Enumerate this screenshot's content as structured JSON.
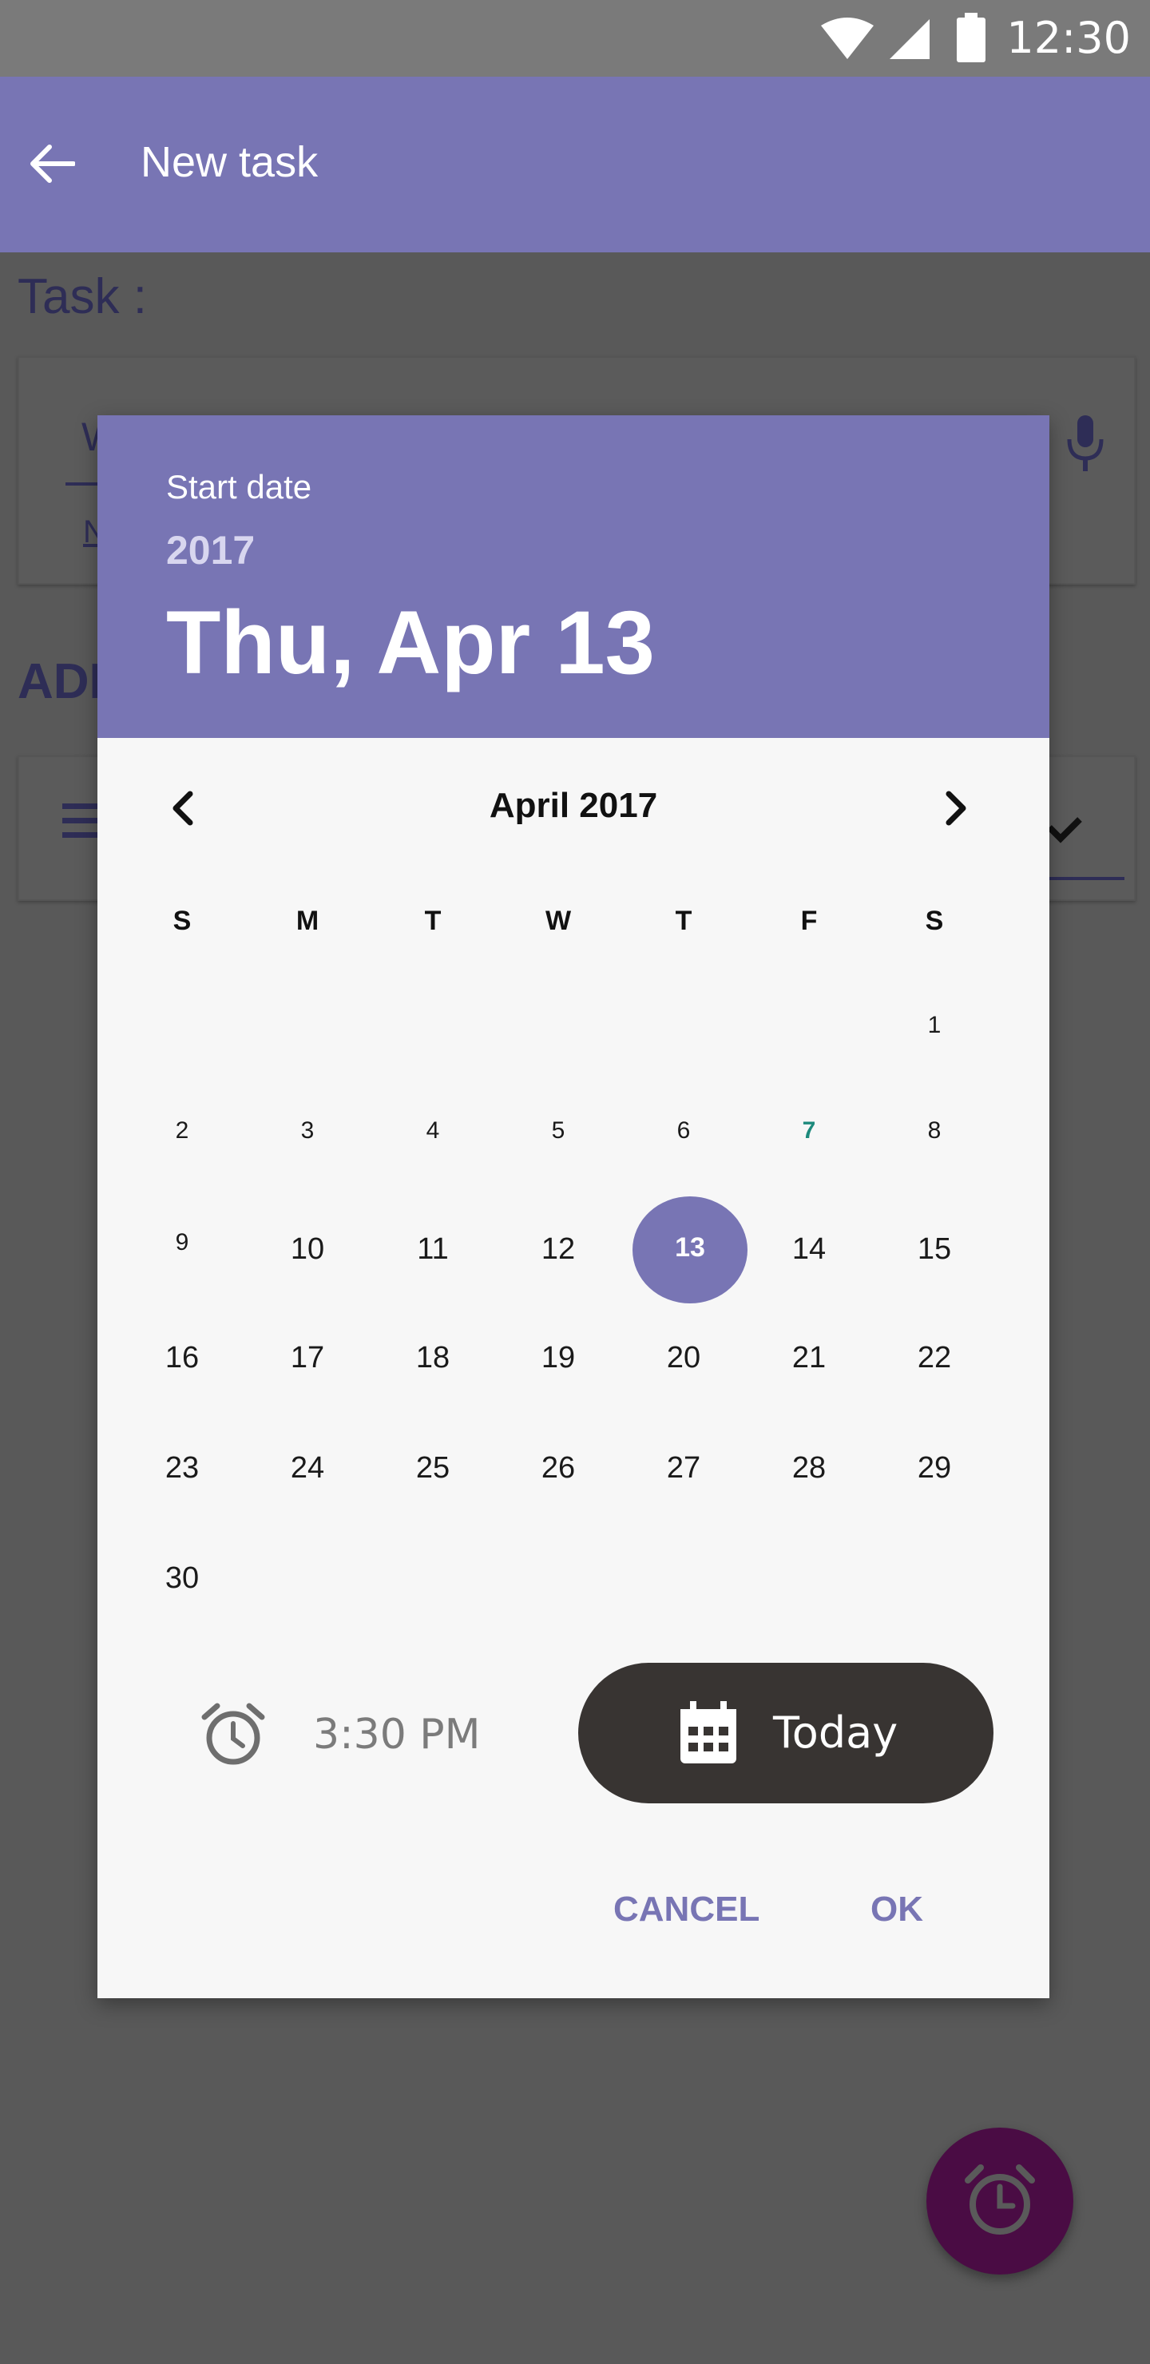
{
  "status_bar": {
    "time": "12:30"
  },
  "app_bar": {
    "title": "New task"
  },
  "background": {
    "task_label": "Task :",
    "field_letter": "W",
    "field_hint": "N",
    "section_label": "ADD"
  },
  "dialog": {
    "caption": "Start date",
    "year": "2017",
    "selected_date": "Thu, Apr 13",
    "month_title": "April 2017",
    "weekdays": [
      "S",
      "M",
      "T",
      "W",
      "T",
      "F",
      "S"
    ],
    "days": [
      "1",
      "2",
      "3",
      "4",
      "5",
      "6",
      "7",
      "8",
      "9",
      "10",
      "11",
      "12",
      "13",
      "14",
      "15",
      "16",
      "17",
      "18",
      "19",
      "20",
      "21",
      "22",
      "23",
      "24",
      "25",
      "26",
      "27",
      "28",
      "29",
      "30"
    ],
    "selected_day": "13",
    "today_day": "7",
    "time_value": "3:30 PM",
    "today_button": "Today",
    "cancel_label": "CANCEL",
    "ok_label": "OK"
  },
  "colors": {
    "primary": "#7875b4",
    "today_accent": "#1d8a7c",
    "fab": "#4a0c44",
    "today_button_bg": "#383432"
  },
  "icons": {
    "back": "arrow-left-icon",
    "mic": "microphone-icon",
    "prev": "chevron-left-icon",
    "next": "chevron-right-icon",
    "alarm": "alarm-icon",
    "calendar": "calendar-icon",
    "fab": "alarm-clock-icon"
  }
}
